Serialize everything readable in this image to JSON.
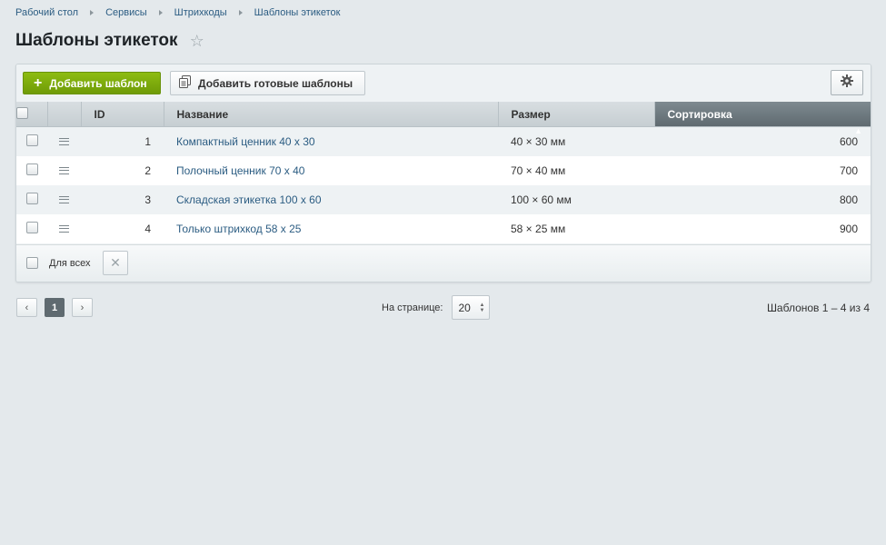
{
  "breadcrumb": [
    "Рабочий стол",
    "Сервисы",
    "Штрихкоды",
    "Шаблоны этикеток"
  ],
  "title": "Шаблоны этикеток",
  "toolbar": {
    "add_label": "Добавить шаблон",
    "add_ready_label": "Добавить готовые шаблоны"
  },
  "table": {
    "columns": {
      "id": "ID",
      "name": "Название",
      "size": "Размер",
      "sort": "Сортировка"
    },
    "rows": [
      {
        "id": "1",
        "name": "Компактный ценник 40 x 30",
        "size": "40 × 30 мм",
        "sort": "600"
      },
      {
        "id": "2",
        "name": "Полочный ценник 70 x 40",
        "size": "70 × 40 мм",
        "sort": "700"
      },
      {
        "id": "3",
        "name": "Складская этикетка 100 x 60",
        "size": "100 × 60 мм",
        "sort": "800"
      },
      {
        "id": "4",
        "name": "Только штрихкод 58 x 25",
        "size": "58 × 25 мм",
        "sort": "900"
      }
    ]
  },
  "footer": {
    "for_all_label": "Для всех"
  },
  "pagination": {
    "current_page": "1",
    "per_page_label": "На странице:",
    "per_page_value": "20",
    "total_text": "Шаблонов 1 – 4 из 4"
  }
}
